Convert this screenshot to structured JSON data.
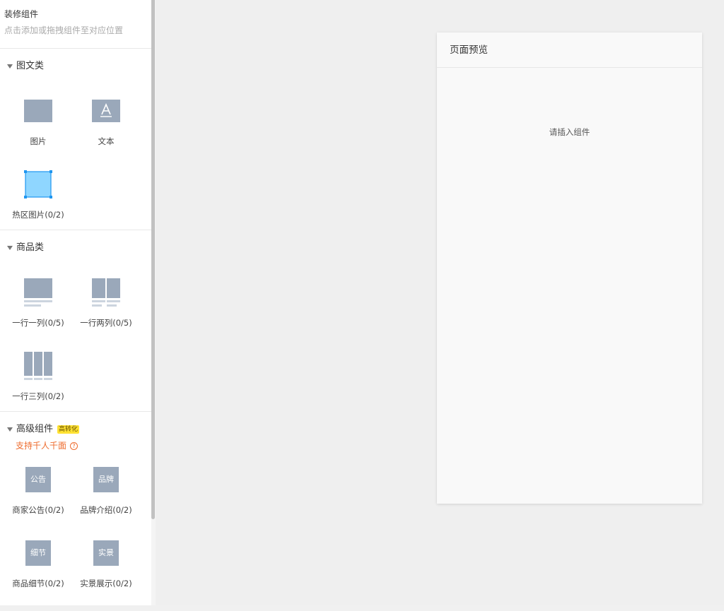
{
  "sidebar": {
    "title": "装修组件",
    "subtitle": "点击添加或拖拽组件至对应位置",
    "sections": [
      {
        "title": "图文类",
        "items": [
          {
            "label": "图片",
            "icon": "image-icon"
          },
          {
            "label": "文本",
            "icon": "text-icon"
          },
          {
            "label": "热区图片(0/2)",
            "icon": "hotspot-image-icon"
          }
        ]
      },
      {
        "title": "商品类",
        "items": [
          {
            "label": "一行一列(0/5)",
            "icon": "one-column-icon"
          },
          {
            "label": "一行两列(0/5)",
            "icon": "two-column-icon"
          },
          {
            "label": "一行三列(0/2)",
            "icon": "three-column-icon"
          }
        ]
      },
      {
        "title": "高级组件",
        "badge": "高转化",
        "note": "支持千人千面",
        "note_icon": "?",
        "items": [
          {
            "label": "商家公告(0/2)",
            "icon_text": "公告"
          },
          {
            "label": "品牌介绍(0/2)",
            "icon_text": "品牌"
          },
          {
            "label": "商品细节(0/2)",
            "icon_text": "细节"
          },
          {
            "label": "实景展示(0/2)",
            "icon_text": "实景"
          }
        ]
      }
    ]
  },
  "preview": {
    "title": "页面预览",
    "empty_tip": "请插入组件"
  },
  "colors": {
    "icon_fill": "#9aa8ba",
    "hotspot_fill": "#8fd6ff",
    "hotspot_border": "#1f96f0",
    "note_orange": "#ee6b2d",
    "badge_yellow": "#ffe234"
  }
}
